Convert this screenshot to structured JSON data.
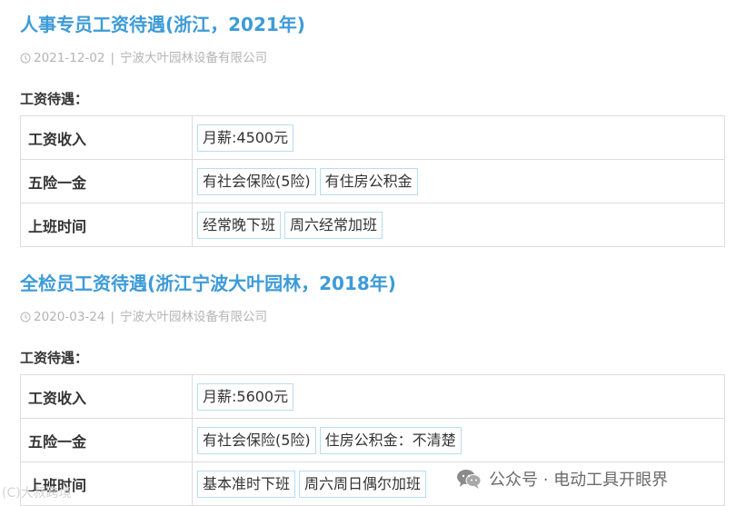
{
  "sections": [
    {
      "title": "人事专员工资待遇(浙江，2021年)",
      "date": "2021-12-02",
      "company": "宁波大叶园林设备有限公司",
      "heading": "工资待遇：",
      "rows": [
        {
          "label": "工资收入",
          "tags": [
            "月薪:4500元"
          ]
        },
        {
          "label": "五险一金",
          "tags": [
            "有社会保险(5险)",
            "有住房公积金"
          ]
        },
        {
          "label": "上班时间",
          "tags": [
            "经常晚下班",
            "周六经常加班"
          ]
        }
      ]
    },
    {
      "title": "全检员工资待遇(浙江宁波大叶园林，2018年)",
      "date": "2020-03-24",
      "company": "宁波大叶园林设备有限公司",
      "heading": "工资待遇：",
      "rows": [
        {
          "label": "工资收入",
          "tags": [
            "月薪:5600元"
          ]
        },
        {
          "label": "五险一金",
          "tags": [
            "有社会保险(5险)",
            "住房公积金：不清楚"
          ]
        },
        {
          "label": "上班时间",
          "tags": [
            "基本准时下班",
            "周六周日偶尔加班"
          ]
        }
      ]
    }
  ],
  "meta_separator": "|",
  "watermark_left": "(C)大叔跨境",
  "watermark_right": "公众号 · 电动工具开眼界",
  "colors": {
    "title": "#3d9bd8",
    "tag_border": "#b9dcf1",
    "meta": "#b4b4b4"
  }
}
